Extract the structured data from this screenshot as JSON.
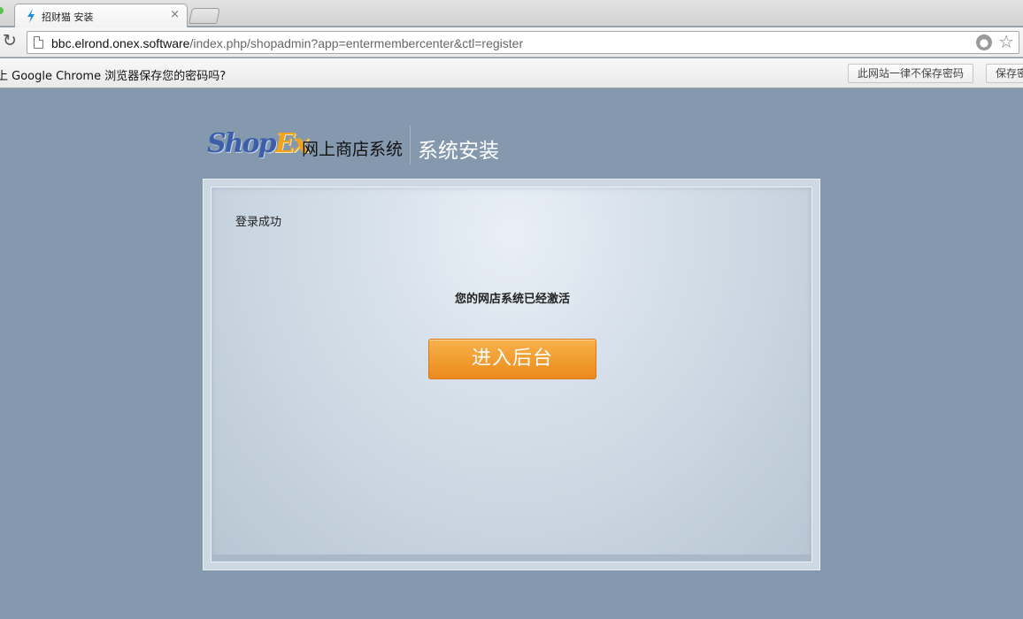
{
  "browser": {
    "tab_title": "招财猫 安装",
    "tab_close": "×",
    "url_host": "bbc.elrond.onex.software",
    "url_path": "/index.php/shopadmin?app=entermembercenter&ctl=register"
  },
  "infobar": {
    "message": "上 Google Chrome 浏览器保存您的密码吗?",
    "never_button": "此网站一律不保存密码",
    "save_button": "保存密"
  },
  "header": {
    "logo_part1": "Shop",
    "logo_part2": "Ex",
    "subtitle": "网上商店系统",
    "title": "系统安装"
  },
  "panel": {
    "status": "登录成功",
    "message": "您的网店系统已经激活",
    "enter_button": "进入后台"
  },
  "colors": {
    "background": "#8499ad",
    "button_accent": "#ec8a1b"
  }
}
